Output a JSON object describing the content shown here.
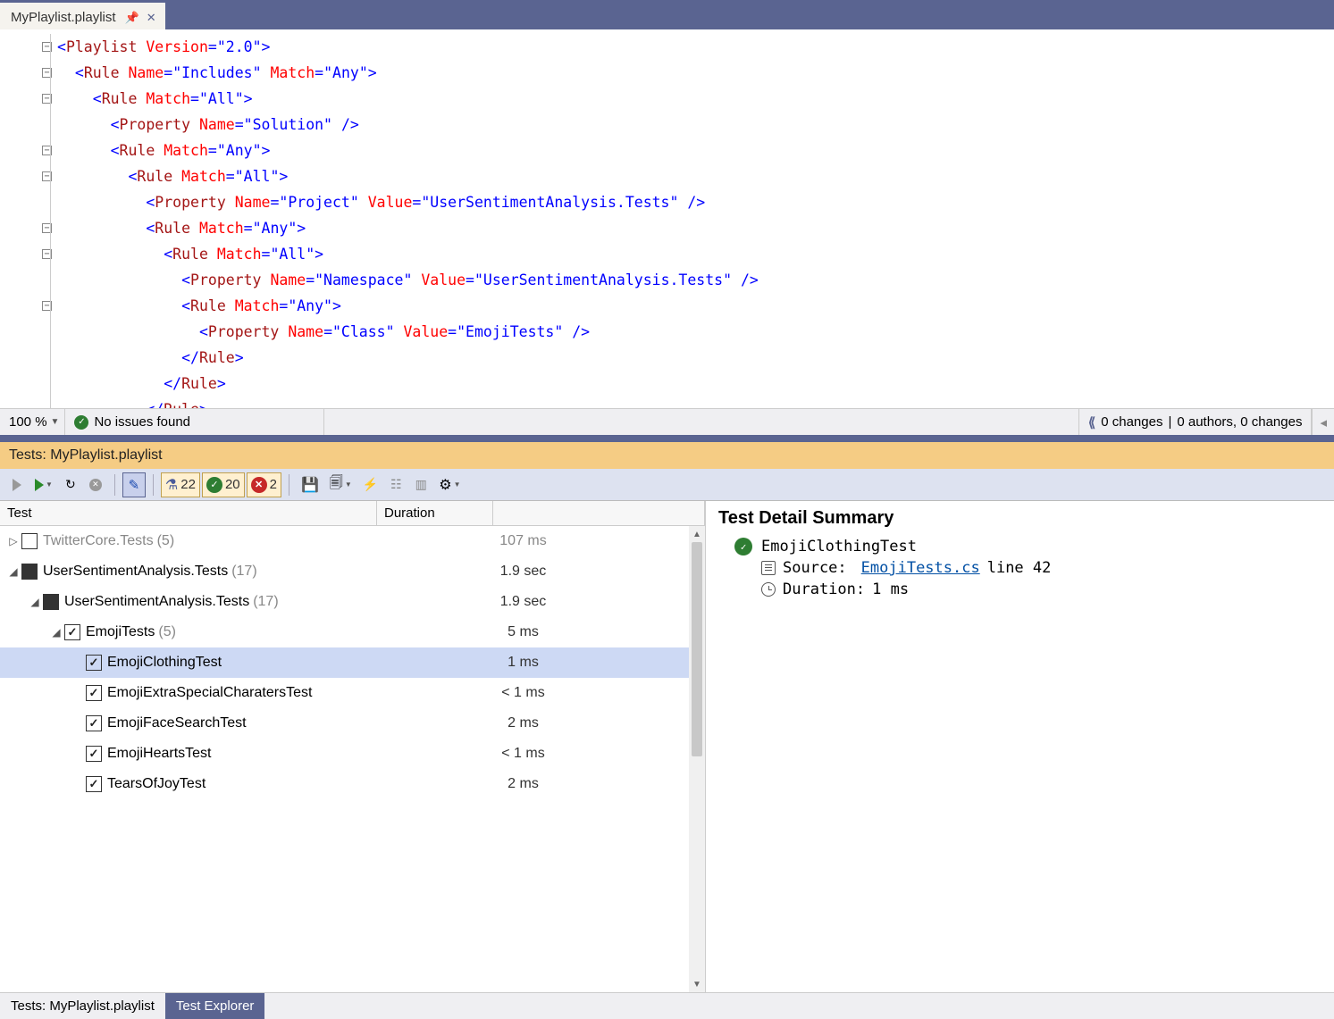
{
  "tab": {
    "filename": "MyPlaylist.playlist"
  },
  "code": {
    "lines": [
      {
        "indent": 0,
        "fold": true,
        "html": "<span class='punc'>&lt;</span><span class='tag'>Playlist</span> <span class='attr'>Version</span><span class='punc'>=</span><span class='str'>\"2.0\"</span><span class='punc'>&gt;</span>"
      },
      {
        "indent": 1,
        "fold": true,
        "html": "<span class='punc'>&lt;</span><span class='tag'>Rule</span> <span class='attr'>Name</span><span class='punc'>=</span><span class='str'>\"Includes\"</span> <span class='attr'>Match</span><span class='punc'>=</span><span class='str'>\"Any\"</span><span class='punc'>&gt;</span>"
      },
      {
        "indent": 2,
        "fold": true,
        "html": "<span class='punc'>&lt;</span><span class='tag'>Rule</span> <span class='attr'>Match</span><span class='punc'>=</span><span class='str'>\"All\"</span><span class='punc'>&gt;</span>"
      },
      {
        "indent": 3,
        "fold": false,
        "html": "<span class='punc'>&lt;</span><span class='tag'>Property</span> <span class='attr'>Name</span><span class='punc'>=</span><span class='str'>\"Solution\"</span> <span class='punc'>/&gt;</span>"
      },
      {
        "indent": 3,
        "fold": true,
        "html": "<span class='punc'>&lt;</span><span class='tag'>Rule</span> <span class='attr'>Match</span><span class='punc'>=</span><span class='str'>\"Any\"</span><span class='punc'>&gt;</span>"
      },
      {
        "indent": 4,
        "fold": true,
        "html": "<span class='punc'>&lt;</span><span class='tag'>Rule</span> <span class='attr'>Match</span><span class='punc'>=</span><span class='str'>\"All\"</span><span class='punc'>&gt;</span>"
      },
      {
        "indent": 5,
        "fold": false,
        "html": "<span class='punc'>&lt;</span><span class='tag'>Property</span> <span class='attr'>Name</span><span class='punc'>=</span><span class='str'>\"Project\"</span> <span class='attr'>Value</span><span class='punc'>=</span><span class='str'>\"UserSentimentAnalysis.Tests\"</span> <span class='punc'>/&gt;</span>"
      },
      {
        "indent": 5,
        "fold": true,
        "html": "<span class='punc'>&lt;</span><span class='tag'>Rule</span> <span class='attr'>Match</span><span class='punc'>=</span><span class='str'>\"Any\"</span><span class='punc'>&gt;</span>"
      },
      {
        "indent": 6,
        "fold": true,
        "html": "<span class='punc'>&lt;</span><span class='tag'>Rule</span> <span class='attr'>Match</span><span class='punc'>=</span><span class='str'>\"All\"</span><span class='punc'>&gt;</span>"
      },
      {
        "indent": 7,
        "fold": false,
        "html": "<span class='punc'>&lt;</span><span class='tag'>Property</span> <span class='attr'>Name</span><span class='punc'>=</span><span class='str'>\"Namespace\"</span> <span class='attr'>Value</span><span class='punc'>=</span><span class='str'>\"UserSentimentAnalysis.Tests\"</span> <span class='punc'>/&gt;</span>"
      },
      {
        "indent": 7,
        "fold": true,
        "html": "<span class='punc'>&lt;</span><span class='tag'>Rule</span> <span class='attr'>Match</span><span class='punc'>=</span><span class='str'>\"Any\"</span><span class='punc'>&gt;</span>"
      },
      {
        "indent": 8,
        "fold": false,
        "html": "<span class='punc'>&lt;</span><span class='tag'>Property</span> <span class='attr'>Name</span><span class='punc'>=</span><span class='str'>\"Class\"</span> <span class='attr'>Value</span><span class='punc'>=</span><span class='str'>\"EmojiTests\"</span> <span class='punc'>/&gt;</span>"
      },
      {
        "indent": 7,
        "fold": false,
        "html": "<span class='punc'>&lt;/</span><span class='tag'>Rule</span><span class='punc'>&gt;</span>"
      },
      {
        "indent": 6,
        "fold": false,
        "html": "<span class='punc'>&lt;/</span><span class='tag'>Rule</span><span class='punc'>&gt;</span>"
      },
      {
        "indent": 5,
        "fold": false,
        "html": "<span class='punc'>&lt;/</span><span class='tag'>Rule</span><span class='punc'>&gt;</span>"
      }
    ]
  },
  "status": {
    "zoom": "100 %",
    "issues": "No issues found",
    "changes": "0 changes",
    "authors": "0 authors, 0 changes"
  },
  "tests_header": "Tests: MyPlaylist.playlist",
  "toolbar": {
    "total": "22",
    "passed": "20",
    "failed": "2"
  },
  "tree": {
    "cols": {
      "test": "Test",
      "duration": "Duration"
    },
    "rows": [
      {
        "depth": 0,
        "exp": "▷",
        "chk": "empty",
        "label": "TwitterCore.Tests",
        "count": "(5)",
        "dur": "107 ms",
        "dim": true
      },
      {
        "depth": 0,
        "exp": "◢",
        "chk": "filled",
        "label": "UserSentimentAnalysis.Tests",
        "count": "(17)",
        "dur": "1.9 sec"
      },
      {
        "depth": 1,
        "exp": "◢",
        "chk": "filled",
        "label": "UserSentimentAnalysis.Tests",
        "count": "(17)",
        "dur": "1.9 sec"
      },
      {
        "depth": 2,
        "exp": "◢",
        "chk": "checked",
        "label": "EmojiTests",
        "count": "(5)",
        "dur": "5 ms"
      },
      {
        "depth": 3,
        "exp": "",
        "chk": "checked",
        "label": "EmojiClothingTest",
        "count": "",
        "dur": "1 ms",
        "selected": true
      },
      {
        "depth": 3,
        "exp": "",
        "chk": "checked",
        "label": "EmojiExtraSpecialCharatersTest",
        "count": "",
        "dur": "< 1 ms"
      },
      {
        "depth": 3,
        "exp": "",
        "chk": "checked",
        "label": "EmojiFaceSearchTest",
        "count": "",
        "dur": "2 ms"
      },
      {
        "depth": 3,
        "exp": "",
        "chk": "checked",
        "label": "EmojiHeartsTest",
        "count": "",
        "dur": "< 1 ms"
      },
      {
        "depth": 3,
        "exp": "",
        "chk": "checked",
        "label": "TearsOfJoyTest",
        "count": "",
        "dur": "2 ms"
      }
    ]
  },
  "detail": {
    "title": "Test Detail Summary",
    "name": "EmojiClothingTest",
    "source_label": "Source:",
    "source_file": "EmojiTests.cs",
    "source_line": "line 42",
    "duration_label": "Duration:",
    "duration_value": "1 ms"
  },
  "bottom_tabs": {
    "playlist": "Tests: MyPlaylist.playlist",
    "explorer": "Test Explorer"
  }
}
